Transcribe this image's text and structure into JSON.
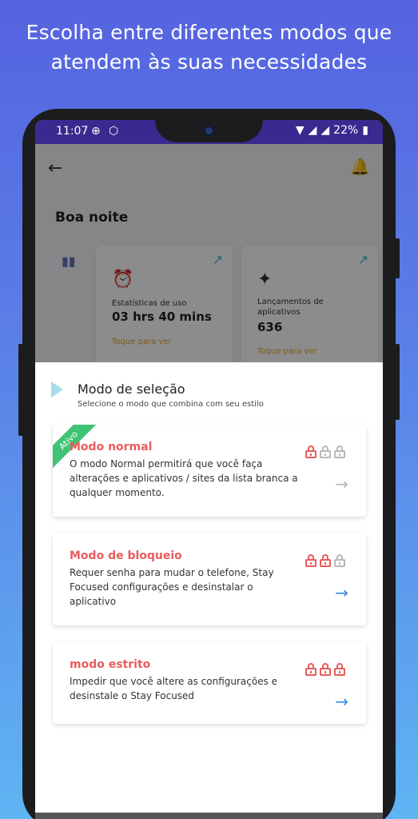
{
  "headline": {
    "line1": "Escolha entre diferentes modos que",
    "line2": "atendem às suas necessidades"
  },
  "statusbar": {
    "time": "11:07",
    "battery": "22%",
    "icons": [
      "target-icon",
      "hex-gear-icon",
      "wifi-icon",
      "signal-icon",
      "battery-icon"
    ]
  },
  "app": {
    "greeting": "Boa noite",
    "cards": [
      {
        "icon": "alarm-clock-icon",
        "label": "Estatísticas de uso",
        "value": "03 hrs 40 mins",
        "link": "Toque para ver"
      },
      {
        "icon": "rocket-icon",
        "label": "Lançamentos de aplicativos",
        "value": "636",
        "link": "Toque para ver"
      }
    ]
  },
  "sheet": {
    "title": "Modo de seleção",
    "subtitle": "Selecione o modo que combina com seu estilo",
    "modes": [
      {
        "title": "Modo normal",
        "description": "O modo Normal permitirá que você faça alterações e aplicativos / sites da lista branca a qualquer momento.",
        "badge": "Ativo",
        "locks_active": 1
      },
      {
        "title": "Modo de bloqueio",
        "description": "Requer senha para mudar o telefone, Stay Focused configurações e desinstalar o aplicativo",
        "locks_active": 2
      },
      {
        "title": "modo estrito",
        "description": "Impedir que você altere as configurações e desinstale o Stay Focused",
        "locks_active": 3
      }
    ]
  },
  "colors": {
    "accent_red": "#e85c5c",
    "active_green": "#3fc374",
    "arrow_blue": "#3d8ee8",
    "statusbar": "#3a2a8f"
  }
}
